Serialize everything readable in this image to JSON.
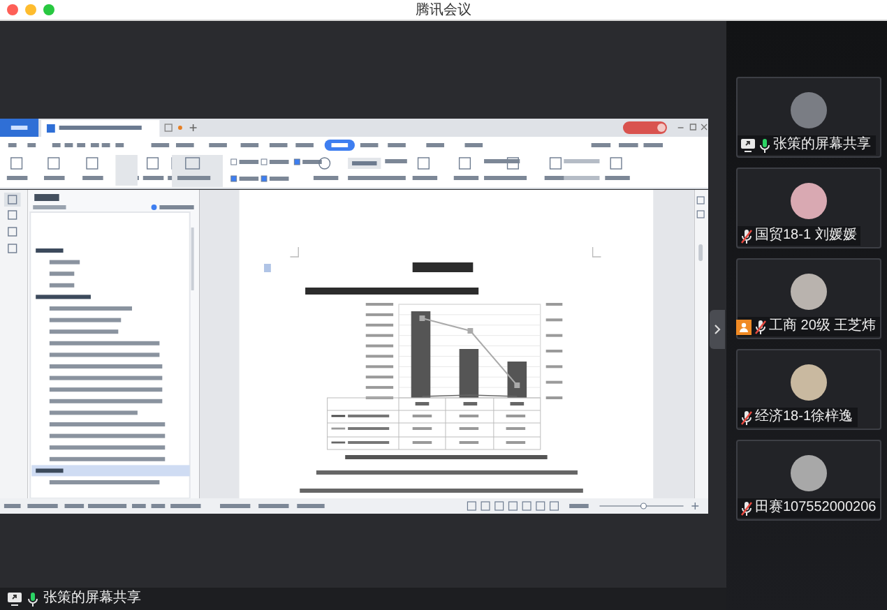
{
  "window": {
    "title": "腾讯会议"
  },
  "screen_share": {
    "label": "张策的屏幕共享",
    "muted": false
  },
  "participants": [
    {
      "name": "张策的屏幕共享",
      "muted": false,
      "sharing": true,
      "host": false
    },
    {
      "name": "国贸18-1 刘媛媛",
      "muted": true,
      "sharing": false,
      "host": false
    },
    {
      "name": "工商 20级 王芝炜",
      "muted": true,
      "sharing": false,
      "host": true
    },
    {
      "name": "经济18-1徐梓逸",
      "muted": true,
      "sharing": false,
      "host": false
    },
    {
      "name": "田赛107552000206",
      "muted": true,
      "sharing": false,
      "host": false
    }
  ]
}
